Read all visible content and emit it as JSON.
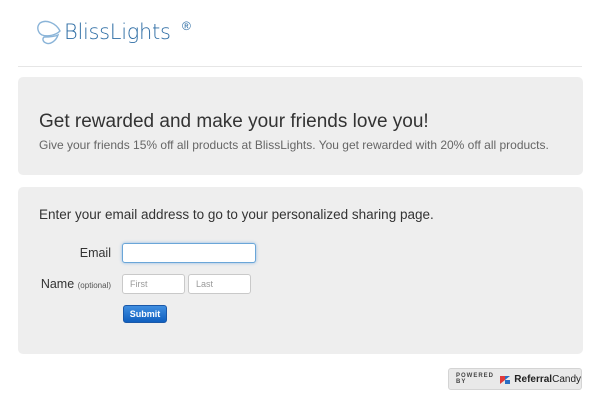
{
  "brand": {
    "name": "BlissLights",
    "registered_mark": "®"
  },
  "intro": {
    "headline": "Get rewarded and make your friends love you!",
    "subline": "Give your friends 15% off all products at BlissLights. You get rewarded with 20% off all products."
  },
  "form": {
    "prompt": "Enter your email address to go to your personalized sharing page.",
    "email_label": "Email",
    "email_value": "",
    "name_label": "Name",
    "name_optional": "(optional)",
    "first_placeholder": "First",
    "last_placeholder": "Last",
    "submit_label": "Submit"
  },
  "footer": {
    "powered_by": "POWERED BY",
    "provider_strong": "Referral",
    "provider_rest": "Candy"
  },
  "colors": {
    "logo_blue": "#2f6ea5",
    "submit_blue": "#0f5fbf",
    "panel_gray": "#eeeeee"
  }
}
